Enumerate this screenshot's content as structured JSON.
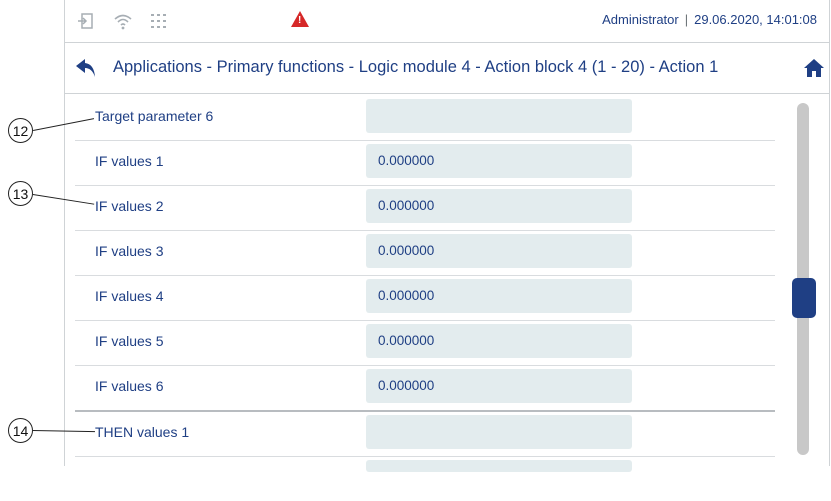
{
  "statusbar": {
    "user": "Administrator",
    "separator": "|",
    "datetime": "29.06.2020, 14:01:08",
    "icons": [
      "login-icon",
      "wifi-icon",
      "network-icon",
      "warning-icon"
    ]
  },
  "navbar": {
    "breadcrumb": "Applications - Primary functions - Logic module 4 - Action block 4 (1 - 20) - Action 1"
  },
  "rows": [
    {
      "label": "Target parameter 6",
      "value": ""
    },
    {
      "label": "IF values 1",
      "value": "0.000000"
    },
    {
      "label": "IF values 2",
      "value": "0.000000"
    },
    {
      "label": "IF values 3",
      "value": "0.000000"
    },
    {
      "label": "IF values 4",
      "value": "0.000000"
    },
    {
      "label": "IF values 5",
      "value": "0.000000"
    },
    {
      "label": "IF values 6",
      "value": "0.000000"
    },
    {
      "label": "THEN values 1",
      "value": ""
    }
  ],
  "callouts": {
    "c12": "12",
    "c13": "13",
    "c14": "14"
  },
  "colors": {
    "accent": "#1f3f84",
    "warning": "#d62828",
    "field": "#e3ecee"
  }
}
